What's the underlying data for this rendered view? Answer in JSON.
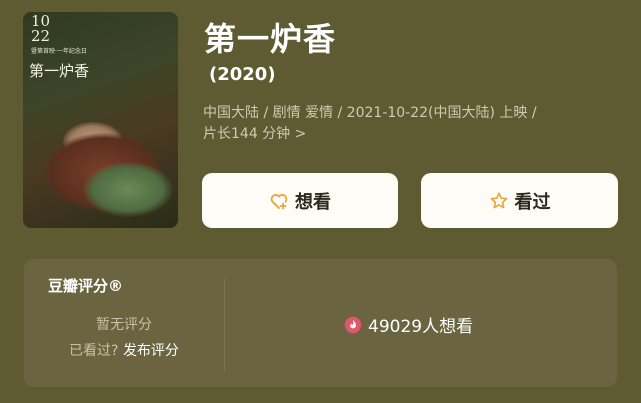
{
  "poster": {
    "date": "10\n22",
    "tagline": "暨第首映·一年纪念日",
    "title": "第一炉香"
  },
  "movie": {
    "title": "第一炉香",
    "year": "(2020)",
    "meta_line1": "中国大陆 / 剧情 爱情 / 2021-10-22(中国大陆) 上映 /",
    "meta_line2": "片长144 分钟 >"
  },
  "actions": {
    "want_label": "想看",
    "seen_label": "看过"
  },
  "rating": {
    "title": "豆瓣评分®",
    "no_rating": "暂无评分",
    "seen_question": "已看过?",
    "post_rating": "发布评分",
    "want_count": "49029人想看"
  },
  "colors": {
    "background": "#5e5a32",
    "panel": "#6a6540",
    "button": "#fdfcf6",
    "accent": "#e8a83a",
    "flame": "#e0566b"
  }
}
